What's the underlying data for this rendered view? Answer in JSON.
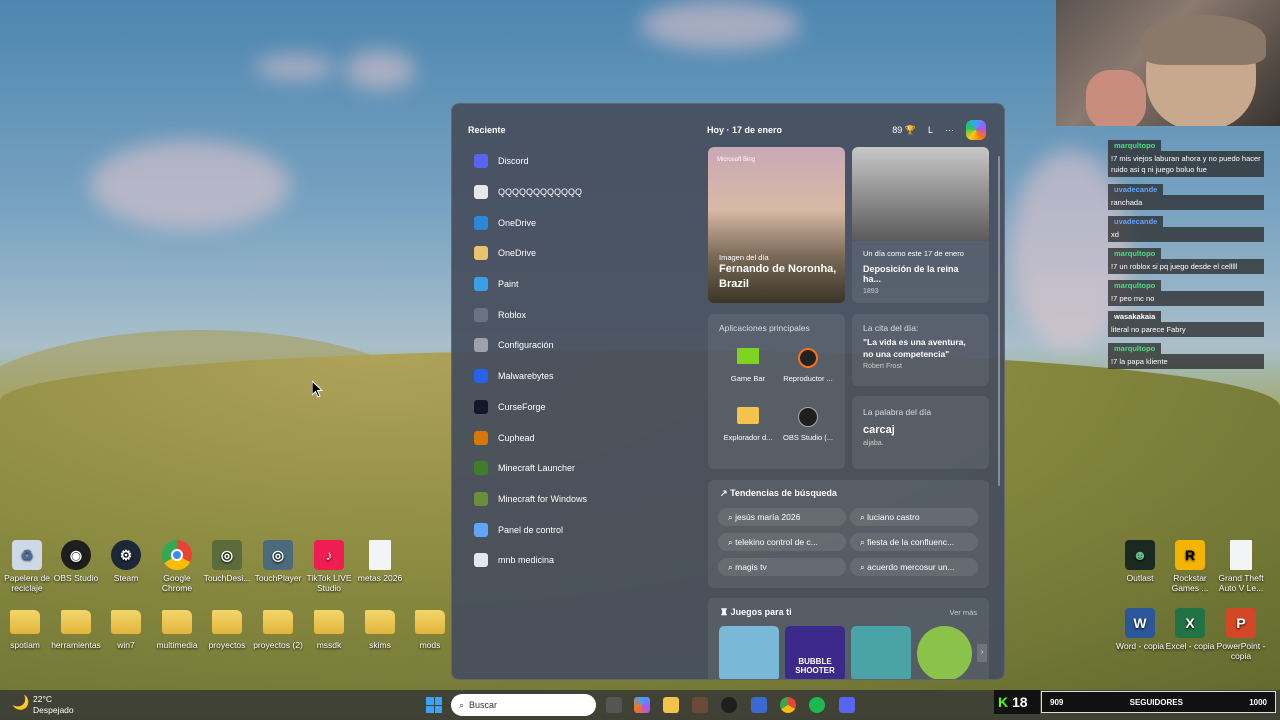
{
  "desktop": {
    "icons_row1": [
      {
        "label": "Papelera de reciclaje",
        "icon": "recycle-bin-icon"
      },
      {
        "label": "OBS Studio",
        "icon": "obs-icon"
      },
      {
        "label": "Steam",
        "icon": "steam-icon"
      },
      {
        "label": "Google Chrome",
        "icon": "chrome-icon"
      },
      {
        "label": "TouchDesi...",
        "icon": "touchdesigner-icon"
      },
      {
        "label": "TouchPlayer",
        "icon": "touchplayer-icon"
      },
      {
        "label": "TikTok LIVE Studio",
        "icon": "tiktok-icon"
      },
      {
        "label": "metas 2026",
        "icon": "file-icon"
      }
    ],
    "icons_row2": [
      {
        "label": "spotiam"
      },
      {
        "label": "herramientas"
      },
      {
        "label": "win7"
      },
      {
        "label": "multimedia"
      },
      {
        "label": "proyectos"
      },
      {
        "label": "proyectos (2)"
      },
      {
        "label": "mssdk"
      },
      {
        "label": "skims"
      },
      {
        "label": "mods"
      }
    ],
    "icons_right": [
      {
        "label": "Outlast"
      },
      {
        "label": "Rockstar Games ..."
      },
      {
        "label": "Grand Theft Auto V Le..."
      },
      {
        "label": "Word - copia"
      },
      {
        "label": "Excel - copia"
      },
      {
        "label": "PowerPoint - copia"
      }
    ]
  },
  "panel": {
    "recent_title": "Reciente",
    "recent": [
      {
        "label": "Discord",
        "icon": "discord-icon",
        "color": "#5865f2"
      },
      {
        "label": "QQQQQQQQQQQQ",
        "icon": "search-icon",
        "color": "#e5e7eb"
      },
      {
        "label": "OneDrive",
        "icon": "onedrive-icon",
        "color": "#2b88d8"
      },
      {
        "label": "OneDrive",
        "icon": "onedrive-folder-icon",
        "color": "#e9c46a"
      },
      {
        "label": "Paint",
        "icon": "paint-icon",
        "color": "#3aa0e6"
      },
      {
        "label": "Roblox",
        "icon": "roblox-icon",
        "color": "#6b7280"
      },
      {
        "label": "Configuración",
        "icon": "gear-icon",
        "color": "#9ca3af"
      },
      {
        "label": "Malwarebytes",
        "icon": "malwarebytes-icon",
        "color": "#2563eb"
      },
      {
        "label": "CurseForge",
        "icon": "curseforge-icon",
        "color": "#111827"
      },
      {
        "label": "Cuphead",
        "icon": "cuphead-icon",
        "color": "#d97706"
      },
      {
        "label": "Minecraft Launcher",
        "icon": "minecraft-icon",
        "color": "#3f7d2a"
      },
      {
        "label": "Minecraft for Windows",
        "icon": "minecraft-icon",
        "color": "#6b8e3a"
      },
      {
        "label": "Panel de control",
        "icon": "control-panel-icon",
        "color": "#60a5fa"
      },
      {
        "label": "mnb medicina",
        "icon": "search-icon",
        "color": "#e5e7eb"
      }
    ],
    "today": "Hoy",
    "date": "17 de enero",
    "points": "89",
    "user_initial": "L",
    "more": "···",
    "image_of_day": {
      "brand": "Microsoft Bing",
      "label": "Imagen del día",
      "title": "Fernando de Noronha, Brazil"
    },
    "history": {
      "label": "Un día como este 17 de enero",
      "title": "Deposición de la reina ha...",
      "year": "1893"
    },
    "apps_title": "Aplicaciones principales",
    "apps": [
      {
        "label": "Game Bar",
        "icon": "gamebar-icon"
      },
      {
        "label": "Reproductor ...",
        "icon": "media-player-icon"
      },
      {
        "label": "Explorador d...",
        "icon": "file-explorer-icon"
      },
      {
        "label": "OBS Studio (...",
        "icon": "obs-icon"
      }
    ],
    "quote": {
      "label": "La cita del día:",
      "text": "\"La vida es una aventura, no una competencia\"",
      "author": "Robert Frost"
    },
    "word": {
      "label": "La palabra del día",
      "word": "carcaj",
      "def": "aljaba."
    },
    "trends_title": "Tendencias de búsqueda",
    "trends": [
      "jesús maría 2026",
      "luciano castro",
      "telekino control de c...",
      "fiesta de la confluenc...",
      "magis tv",
      "acuerdo mercosur un..."
    ],
    "games_title": "Juegos para ti",
    "games_more": "Ver más",
    "games": [
      {
        "label": "",
        "color": "#7ab8d8"
      },
      {
        "label": "BUBBLE SHOOTER",
        "color": "#3b2a8a"
      },
      {
        "label": "",
        "color": "#4aa3a6"
      },
      {
        "label": "",
        "color": "#8bc34a"
      }
    ]
  },
  "chat": [
    {
      "user": "marqultopo",
      "msg": "!7 mis viejos laburan ahora y no puedo hacer ruido asi q ni juego boluo fue"
    },
    {
      "user": "uvadecande",
      "msg": "ranchada"
    },
    {
      "user": "uvadecande",
      "msg": "xd"
    },
    {
      "user": "marqultopo",
      "msg": "!7 un roblox si pq juego desde el celllll"
    },
    {
      "user": "marqultopo",
      "msg": "!7 peo mc no"
    },
    {
      "user": "wasakakaia",
      "msg": "literal no parece Fabry"
    },
    {
      "user": "marqultopo",
      "msg": "!7 la papa kliente"
    }
  ],
  "weather": {
    "temp": "22°C",
    "desc": "Despejado"
  },
  "taskbar": {
    "search_placeholder": "Buscar"
  },
  "kick": {
    "viewers": "18",
    "count": "909",
    "label": "SEGUIDORES",
    "goal": "1000"
  }
}
